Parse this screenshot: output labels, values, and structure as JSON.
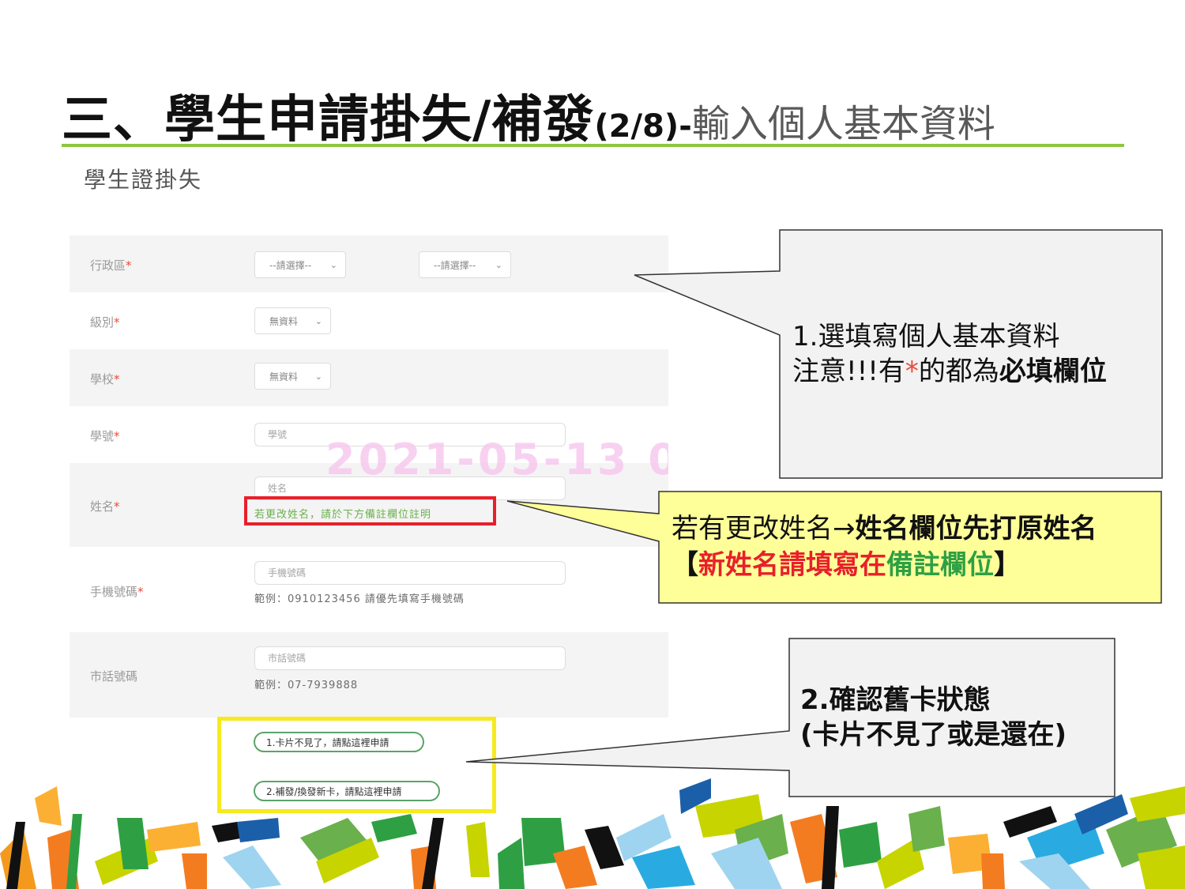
{
  "slide": {
    "title_main": "三、學生申請掛失/補發",
    "title_step": "(2/8)-",
    "title_sub": "輸入個人基本資料"
  },
  "page": {
    "heading": "學生證掛失"
  },
  "form": {
    "required_mark": "*",
    "district": {
      "label": "行政區",
      "select1": "--請選擇--",
      "select2": "--請選擇--"
    },
    "grade": {
      "label": "級別",
      "value": "無資料"
    },
    "school": {
      "label": "學校",
      "value": "無資料"
    },
    "student_id": {
      "label": "學號",
      "placeholder": "學號"
    },
    "name": {
      "label": "姓名",
      "placeholder": "姓名",
      "note": "若更改姓名，請於下方備註欄位註明"
    },
    "mobile": {
      "label": "手機號碼",
      "placeholder": "手機號碼",
      "hint": "範例：0910123456 請優先填寫手機號碼"
    },
    "phone": {
      "label": "市話號碼",
      "placeholder": "市話號碼",
      "hint": "範例：07-7939888"
    },
    "options": [
      {
        "label": "1.卡片不見了，請點這裡申請"
      },
      {
        "label": "2.補發/換發新卡，請點這裡申請"
      }
    ]
  },
  "watermark": "2021-05-13  0",
  "callouts": {
    "c1": {
      "line1": "1.選填寫個人基本資料",
      "line2_a": "注意!!!有",
      "line2_star": "*",
      "line2_b": "的都為",
      "line2_bold": "必填欄位"
    },
    "c2": {
      "line1_a": "若有更改姓名→",
      "line1_bold": "姓名欄位先打原姓名",
      "line2_open": "【",
      "line2_red": "新姓名請填寫在",
      "line2_green": "備註欄位",
      "line2_close": "】"
    },
    "c3": {
      "line1": "2.確認舊卡狀態",
      "line2": "(卡片不見了或是還在)"
    }
  },
  "colors": {
    "accent_green": "#8dc63f",
    "highlight_red": "#e8202a",
    "highlight_yellow": "#f7ea1c",
    "callout_gray": "#f2f2f2",
    "callout_yellow": "#ffff99"
  }
}
